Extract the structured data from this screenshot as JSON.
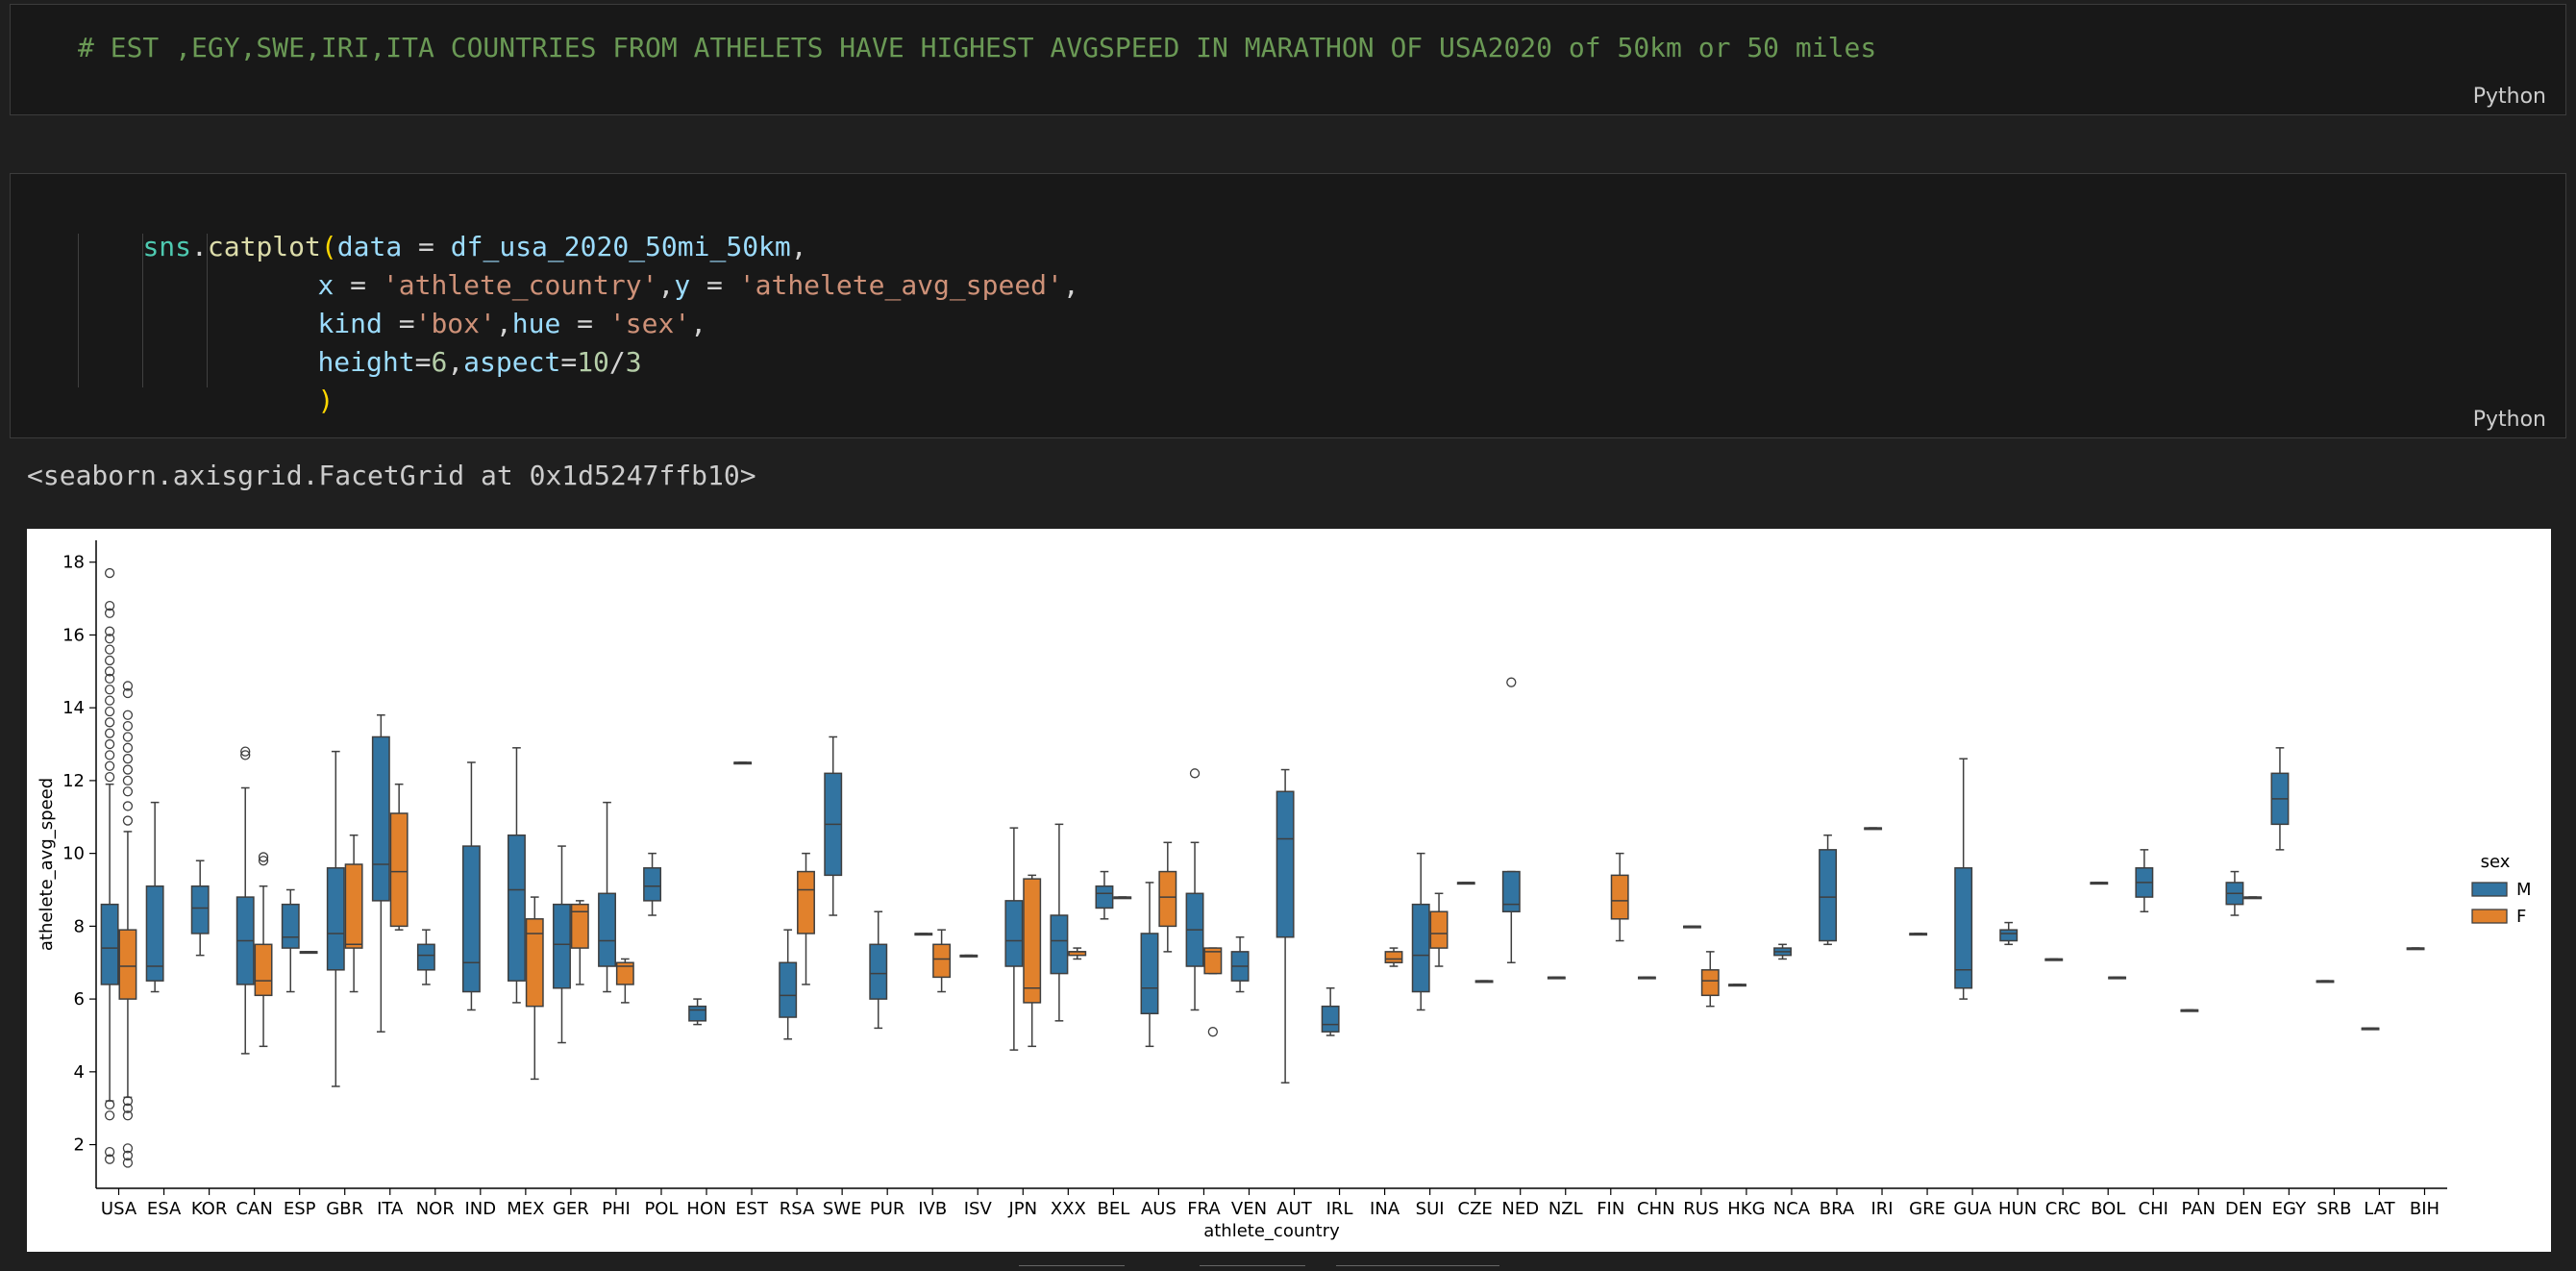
{
  "cell1": {
    "comment": "# EST ,EGY,SWE,IRI,ITA COUNTRIES FROM ATHELETS HAVE HIGHEST AVGSPEED IN MARATHON OF USA2020 of 50km or 50 miles",
    "language": "Python"
  },
  "cell2": {
    "lines": [
      [
        "sns",
        ".",
        "catplot",
        "(",
        "data",
        " = ",
        "df_usa_2020_50mi_50km",
        ","
      ],
      [
        "x",
        " = ",
        "'athlete_country'",
        ",",
        "y",
        " = ",
        "'athelete_avg_speed'",
        ","
      ],
      [
        "kind",
        " =",
        "'box'",
        ",",
        "hue",
        " = ",
        "'sex'",
        ","
      ],
      [
        "height",
        "=",
        "6",
        ",",
        "aspect",
        "=",
        "10",
        "/",
        "3"
      ],
      [
        ")"
      ]
    ],
    "language": "Python"
  },
  "output": {
    "repr": "<seaborn.axisgrid.FacetGrid at 0x1d5247ffb10>"
  },
  "colors": {
    "M": "#3274a1",
    "F": "#e1812c"
  },
  "chart_data": {
    "type": "box",
    "xlabel": "athlete_country",
    "ylabel": "athelete_avg_speed",
    "ylim": [
      0.8,
      18.6
    ],
    "yticks": [
      2,
      4,
      6,
      8,
      10,
      12,
      14,
      16,
      18
    ],
    "legend": {
      "title": "sex",
      "placement": "right",
      "entries": [
        "M",
        "F"
      ]
    },
    "categories": [
      "USA",
      "ESA",
      "KOR",
      "CAN",
      "ESP",
      "GBR",
      "ITA",
      "NOR",
      "IND",
      "MEX",
      "GER",
      "PHI",
      "POL",
      "HON",
      "EST",
      "RSA",
      "SWE",
      "PUR",
      "IVB",
      "ISV",
      "JPN",
      "XXX",
      "BEL",
      "AUS",
      "FRA",
      "VEN",
      "AUT",
      "IRL",
      "INA",
      "SUI",
      "CZE",
      "NED",
      "NZL",
      "FIN",
      "CHN",
      "RUS",
      "HKG",
      "NCA",
      "BRA",
      "IRI",
      "GRE",
      "GUA",
      "HUN",
      "CRC",
      "BOL",
      "CHI",
      "PAN",
      "DEN",
      "EGY",
      "SRB",
      "LAT",
      "BIH"
    ],
    "boxes": [
      {
        "c": "USA",
        "sex": "M",
        "min": 3.2,
        "q1": 6.4,
        "med": 7.4,
        "q3": 8.6,
        "max": 11.9,
        "out": [
          17.7,
          16.8,
          16.6,
          16.1,
          15.9,
          15.6,
          15.3,
          15.0,
          14.8,
          14.5,
          14.2,
          13.9,
          13.6,
          13.3,
          13.0,
          12.7,
          12.4,
          12.1,
          3.1,
          2.8,
          1.8,
          1.6
        ]
      },
      {
        "c": "USA",
        "sex": "F",
        "min": 3.3,
        "q1": 6.0,
        "med": 6.9,
        "q3": 7.9,
        "max": 10.6,
        "out": [
          14.6,
          14.4,
          13.8,
          13.5,
          13.2,
          12.9,
          12.6,
          12.3,
          12.0,
          11.7,
          11.3,
          10.9,
          3.2,
          3.0,
          2.8,
          1.9,
          1.7,
          1.5
        ]
      },
      {
        "c": "ESA",
        "sex": "M",
        "min": 6.2,
        "q1": 6.5,
        "med": 6.9,
        "q3": 9.1,
        "max": 11.4,
        "out": []
      },
      {
        "c": "KOR",
        "sex": "M",
        "min": 7.2,
        "q1": 7.8,
        "med": 8.5,
        "q3": 9.1,
        "max": 9.8,
        "out": []
      },
      {
        "c": "CAN",
        "sex": "M",
        "min": 4.5,
        "q1": 6.4,
        "med": 7.6,
        "q3": 8.8,
        "max": 11.8,
        "out": [
          12.8,
          12.7
        ]
      },
      {
        "c": "CAN",
        "sex": "F",
        "min": 4.7,
        "q1": 6.1,
        "med": 6.5,
        "q3": 7.5,
        "max": 9.1,
        "out": [
          9.9,
          9.8
        ]
      },
      {
        "c": "ESP",
        "sex": "M",
        "min": 6.2,
        "q1": 7.4,
        "med": 7.7,
        "q3": 8.6,
        "max": 9.0,
        "out": []
      },
      {
        "c": "ESP",
        "sex": "F",
        "min": 7.3,
        "q1": 7.3,
        "med": 7.3,
        "q3": 7.3,
        "max": 7.3,
        "out": []
      },
      {
        "c": "GBR",
        "sex": "M",
        "min": 3.6,
        "q1": 6.8,
        "med": 7.8,
        "q3": 9.6,
        "max": 12.8,
        "out": []
      },
      {
        "c": "GBR",
        "sex": "F",
        "min": 6.2,
        "q1": 7.4,
        "med": 7.5,
        "q3": 9.7,
        "max": 10.5,
        "out": []
      },
      {
        "c": "ITA",
        "sex": "M",
        "min": 5.1,
        "q1": 8.7,
        "med": 9.7,
        "q3": 13.2,
        "max": 13.8,
        "out": []
      },
      {
        "c": "ITA",
        "sex": "F",
        "min": 7.9,
        "q1": 8.0,
        "med": 9.5,
        "q3": 11.1,
        "max": 11.9,
        "out": []
      },
      {
        "c": "NOR",
        "sex": "M",
        "min": 6.4,
        "q1": 6.8,
        "med": 7.2,
        "q3": 7.5,
        "max": 7.9,
        "out": []
      },
      {
        "c": "IND",
        "sex": "M",
        "min": 5.7,
        "q1": 6.2,
        "med": 7.0,
        "q3": 10.2,
        "max": 12.5,
        "out": []
      },
      {
        "c": "MEX",
        "sex": "M",
        "min": 5.9,
        "q1": 6.5,
        "med": 9.0,
        "q3": 10.5,
        "max": 12.9,
        "out": []
      },
      {
        "c": "MEX",
        "sex": "F",
        "min": 3.8,
        "q1": 5.8,
        "med": 7.8,
        "q3": 8.2,
        "max": 8.8,
        "out": []
      },
      {
        "c": "GER",
        "sex": "M",
        "min": 4.8,
        "q1": 6.3,
        "med": 7.5,
        "q3": 8.6,
        "max": 10.2,
        "out": []
      },
      {
        "c": "GER",
        "sex": "F",
        "min": 6.4,
        "q1": 7.4,
        "med": 8.4,
        "q3": 8.6,
        "max": 8.7,
        "out": []
      },
      {
        "c": "PHI",
        "sex": "M",
        "min": 6.2,
        "q1": 6.9,
        "med": 7.6,
        "q3": 8.9,
        "max": 11.4,
        "out": []
      },
      {
        "c": "PHI",
        "sex": "F",
        "min": 5.9,
        "q1": 6.4,
        "med": 6.9,
        "q3": 7.0,
        "max": 7.1,
        "out": []
      },
      {
        "c": "POL",
        "sex": "M",
        "min": 8.3,
        "q1": 8.7,
        "med": 9.1,
        "q3": 9.6,
        "max": 10.0,
        "out": []
      },
      {
        "c": "HON",
        "sex": "M",
        "min": 5.3,
        "q1": 5.4,
        "med": 5.7,
        "q3": 5.8,
        "max": 6.0,
        "out": []
      },
      {
        "c": "EST",
        "sex": "M",
        "min": 12.5,
        "q1": 12.5,
        "med": 12.5,
        "q3": 12.5,
        "max": 12.5,
        "out": []
      },
      {
        "c": "RSA",
        "sex": "M",
        "min": 4.9,
        "q1": 5.5,
        "med": 6.1,
        "q3": 7.0,
        "max": 7.9,
        "out": []
      },
      {
        "c": "RSA",
        "sex": "F",
        "min": 6.4,
        "q1": 7.8,
        "med": 9.0,
        "q3": 9.5,
        "max": 10.0,
        "out": []
      },
      {
        "c": "SWE",
        "sex": "M",
        "min": 8.3,
        "q1": 9.4,
        "med": 10.8,
        "q3": 12.2,
        "max": 13.2,
        "out": []
      },
      {
        "c": "PUR",
        "sex": "M",
        "min": 5.2,
        "q1": 6.0,
        "med": 6.7,
        "q3": 7.5,
        "max": 8.4,
        "out": []
      },
      {
        "c": "IVB",
        "sex": "M",
        "min": 7.8,
        "q1": 7.8,
        "med": 7.8,
        "q3": 7.8,
        "max": 7.8,
        "out": []
      },
      {
        "c": "IVB",
        "sex": "F",
        "min": 6.2,
        "q1": 6.6,
        "med": 7.1,
        "q3": 7.5,
        "max": 7.9,
        "out": []
      },
      {
        "c": "ISV",
        "sex": "M",
        "min": 7.2,
        "q1": 7.2,
        "med": 7.2,
        "q3": 7.2,
        "max": 7.2,
        "out": []
      },
      {
        "c": "JPN",
        "sex": "M",
        "min": 4.6,
        "q1": 6.9,
        "med": 7.6,
        "q3": 8.7,
        "max": 10.7,
        "out": []
      },
      {
        "c": "JPN",
        "sex": "F",
        "min": 4.7,
        "q1": 5.9,
        "med": 6.3,
        "q3": 9.3,
        "max": 9.4,
        "out": []
      },
      {
        "c": "XXX",
        "sex": "M",
        "min": 5.4,
        "q1": 6.7,
        "med": 7.6,
        "q3": 8.3,
        "max": 10.8,
        "out": []
      },
      {
        "c": "XXX",
        "sex": "F",
        "min": 7.1,
        "q1": 7.2,
        "med": 7.3,
        "q3": 7.3,
        "max": 7.4,
        "out": []
      },
      {
        "c": "BEL",
        "sex": "M",
        "min": 8.2,
        "q1": 8.5,
        "med": 8.9,
        "q3": 9.1,
        "max": 9.5,
        "out": []
      },
      {
        "c": "BEL",
        "sex": "F",
        "min": 8.8,
        "q1": 8.8,
        "med": 8.8,
        "q3": 8.8,
        "max": 8.8,
        "out": []
      },
      {
        "c": "AUS",
        "sex": "M",
        "min": 4.7,
        "q1": 5.6,
        "med": 6.3,
        "q3": 7.8,
        "max": 9.2,
        "out": []
      },
      {
        "c": "AUS",
        "sex": "F",
        "min": 7.3,
        "q1": 8.0,
        "med": 8.8,
        "q3": 9.5,
        "max": 10.3,
        "out": []
      },
      {
        "c": "FRA",
        "sex": "M",
        "min": 5.7,
        "q1": 6.9,
        "med": 7.9,
        "q3": 8.9,
        "max": 10.3,
        "out": [
          12.2
        ]
      },
      {
        "c": "FRA",
        "sex": "F",
        "min": 6.7,
        "q1": 6.7,
        "med": 7.3,
        "q3": 7.4,
        "max": 7.4,
        "out": [
          5.1
        ]
      },
      {
        "c": "VEN",
        "sex": "M",
        "min": 6.2,
        "q1": 6.5,
        "med": 6.9,
        "q3": 7.3,
        "max": 7.7,
        "out": []
      },
      {
        "c": "AUT",
        "sex": "M",
        "min": 3.7,
        "q1": 7.7,
        "med": 10.4,
        "q3": 11.7,
        "max": 12.3,
        "out": []
      },
      {
        "c": "IRL",
        "sex": "M",
        "min": 5.0,
        "q1": 5.1,
        "med": 5.3,
        "q3": 5.8,
        "max": 6.3,
        "out": []
      },
      {
        "c": "INA",
        "sex": "F",
        "min": 6.9,
        "q1": 7.0,
        "med": 7.1,
        "q3": 7.3,
        "max": 7.4,
        "out": []
      },
      {
        "c": "SUI",
        "sex": "M",
        "min": 5.7,
        "q1": 6.2,
        "med": 7.2,
        "q3": 8.6,
        "max": 10.0,
        "out": []
      },
      {
        "c": "SUI",
        "sex": "F",
        "min": 6.9,
        "q1": 7.4,
        "med": 7.8,
        "q3": 8.4,
        "max": 8.9,
        "out": []
      },
      {
        "c": "CZE",
        "sex": "M",
        "min": 9.2,
        "q1": 9.2,
        "med": 9.2,
        "q3": 9.2,
        "max": 9.2,
        "out": []
      },
      {
        "c": "CZE",
        "sex": "F",
        "min": 6.5,
        "q1": 6.5,
        "med": 6.5,
        "q3": 6.5,
        "max": 6.5,
        "out": []
      },
      {
        "c": "NED",
        "sex": "M",
        "min": 7.0,
        "q1": 8.4,
        "med": 8.6,
        "q3": 9.5,
        "max": 9.5,
        "out": [
          14.7
        ]
      },
      {
        "c": "NZL",
        "sex": "M",
        "min": 6.6,
        "q1": 6.6,
        "med": 6.6,
        "q3": 6.6,
        "max": 6.6,
        "out": []
      },
      {
        "c": "FIN",
        "sex": "F",
        "min": 7.6,
        "q1": 8.2,
        "med": 8.7,
        "q3": 9.4,
        "max": 10.0,
        "out": []
      },
      {
        "c": "CHN",
        "sex": "M",
        "min": 6.6,
        "q1": 6.6,
        "med": 6.6,
        "q3": 6.6,
        "max": 6.6,
        "out": []
      },
      {
        "c": "RUS",
        "sex": "M",
        "min": 8.0,
        "q1": 8.0,
        "med": 8.0,
        "q3": 8.0,
        "max": 8.0,
        "out": []
      },
      {
        "c": "RUS",
        "sex": "F",
        "min": 5.8,
        "q1": 6.1,
        "med": 6.5,
        "q3": 6.8,
        "max": 7.3,
        "out": []
      },
      {
        "c": "HKG",
        "sex": "M",
        "min": 6.4,
        "q1": 6.4,
        "med": 6.4,
        "q3": 6.4,
        "max": 6.4,
        "out": []
      },
      {
        "c": "NCA",
        "sex": "M",
        "min": 7.1,
        "q1": 7.2,
        "med": 7.3,
        "q3": 7.4,
        "max": 7.5,
        "out": []
      },
      {
        "c": "BRA",
        "sex": "M",
        "min": 7.5,
        "q1": 7.6,
        "med": 8.8,
        "q3": 10.1,
        "max": 10.5,
        "out": []
      },
      {
        "c": "IRI",
        "sex": "M",
        "min": 10.7,
        "q1": 10.7,
        "med": 10.7,
        "q3": 10.7,
        "max": 10.7,
        "out": []
      },
      {
        "c": "GRE",
        "sex": "M",
        "min": 7.8,
        "q1": 7.8,
        "med": 7.8,
        "q3": 7.8,
        "max": 7.8,
        "out": []
      },
      {
        "c": "GUA",
        "sex": "M",
        "min": 6.0,
        "q1": 6.3,
        "med": 6.8,
        "q3": 9.6,
        "max": 12.6,
        "out": []
      },
      {
        "c": "HUN",
        "sex": "M",
        "min": 7.5,
        "q1": 7.6,
        "med": 7.8,
        "q3": 7.9,
        "max": 8.1,
        "out": []
      },
      {
        "c": "CRC",
        "sex": "M",
        "min": 7.1,
        "q1": 7.1,
        "med": 7.1,
        "q3": 7.1,
        "max": 7.1,
        "out": []
      },
      {
        "c": "BOL",
        "sex": "M",
        "min": 9.2,
        "q1": 9.2,
        "med": 9.2,
        "q3": 9.2,
        "max": 9.2,
        "out": []
      },
      {
        "c": "BOL",
        "sex": "F",
        "min": 6.6,
        "q1": 6.6,
        "med": 6.6,
        "q3": 6.6,
        "max": 6.6,
        "out": []
      },
      {
        "c": "CHI",
        "sex": "M",
        "min": 8.4,
        "q1": 8.8,
        "med": 9.2,
        "q3": 9.6,
        "max": 10.1,
        "out": []
      },
      {
        "c": "PAN",
        "sex": "M",
        "min": 5.7,
        "q1": 5.7,
        "med": 5.7,
        "q3": 5.7,
        "max": 5.7,
        "out": []
      },
      {
        "c": "DEN",
        "sex": "M",
        "min": 8.3,
        "q1": 8.6,
        "med": 8.9,
        "q3": 9.2,
        "max": 9.5,
        "out": []
      },
      {
        "c": "DEN",
        "sex": "F",
        "min": 8.8,
        "q1": 8.8,
        "med": 8.8,
        "q3": 8.8,
        "max": 8.8,
        "out": []
      },
      {
        "c": "EGY",
        "sex": "M",
        "min": 10.1,
        "q1": 10.8,
        "med": 11.5,
        "q3": 12.2,
        "max": 12.9,
        "out": []
      },
      {
        "c": "SRB",
        "sex": "M",
        "min": 6.5,
        "q1": 6.5,
        "med": 6.5,
        "q3": 6.5,
        "max": 6.5,
        "out": []
      },
      {
        "c": "LAT",
        "sex": "M",
        "min": 5.2,
        "q1": 5.2,
        "med": 5.2,
        "q3": 5.2,
        "max": 5.2,
        "out": []
      },
      {
        "c": "BIH",
        "sex": "M",
        "min": 7.4,
        "q1": 7.4,
        "med": 7.4,
        "q3": 7.4,
        "max": 7.4,
        "out": []
      }
    ]
  }
}
